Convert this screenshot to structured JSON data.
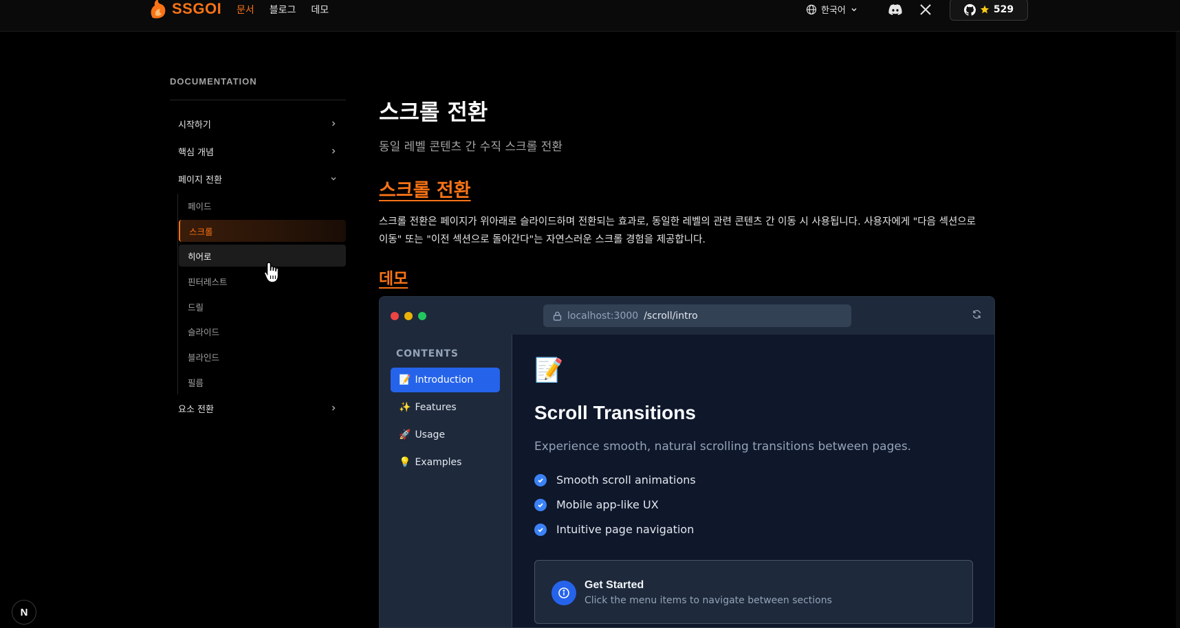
{
  "topnav": {
    "brand": "SSGOI",
    "links": [
      {
        "label": "문서",
        "active": true
      },
      {
        "label": "블로그",
        "active": false
      },
      {
        "label": "데모",
        "active": false
      }
    ],
    "language": "한국어",
    "github_stars": "529",
    "icons": [
      "globe-icon",
      "chevron-down-icon",
      "discord-icon",
      "x-icon",
      "github-icon",
      "star-icon"
    ]
  },
  "sidebar": {
    "heading": "DOCUMENTATION",
    "sections": [
      {
        "label": "시작하기",
        "expanded": false
      },
      {
        "label": "핵심 개념",
        "expanded": false
      },
      {
        "label": "페이지 전환",
        "expanded": true
      },
      {
        "label": "요소 전환",
        "expanded": false
      }
    ],
    "page_transitions": [
      {
        "label": "페이드",
        "state": "normal"
      },
      {
        "label": "스크롤",
        "state": "active"
      },
      {
        "label": "히어로",
        "state": "hover"
      },
      {
        "label": "핀터레스트",
        "state": "normal"
      },
      {
        "label": "드릴",
        "state": "normal"
      },
      {
        "label": "슬라이드",
        "state": "normal"
      },
      {
        "label": "블라인드",
        "state": "normal"
      },
      {
        "label": "필름",
        "state": "normal"
      }
    ]
  },
  "main": {
    "title": "스크롤 전환",
    "subtitle": "동일 레벨 콘텐츠 간 수직 스크롤 전환",
    "section_heading": "스크롤 전환",
    "paragraph_line1": "스크롤 전환은 페이지가 위아래로 슬라이드하며 전환되는 효과로, 동일한 레벨의 관련 콘텐츠 간 이동 시 사용됩니다. 사용자에게 \"다음 섹션으로",
    "paragraph_line2": "이동\" 또는 \"이전 섹션으로 돌아간다\"는 자연스러운 스크롤 경험을 제공합니다.",
    "demo_heading": "데모"
  },
  "demo": {
    "url_host": "localhost:3000",
    "url_path": "/scroll/intro",
    "contents_heading": "CONTENTS",
    "toc": [
      {
        "emoji": "📝",
        "label": "Introduction",
        "active": true
      },
      {
        "emoji": "✨",
        "label": "Features",
        "active": false
      },
      {
        "emoji": "🚀",
        "label": "Usage",
        "active": false
      },
      {
        "emoji": "💡",
        "label": "Examples",
        "active": false
      }
    ],
    "hero_emoji": "📝",
    "title": "Scroll Transitions",
    "subtitle": "Experience smooth, natural scrolling transitions between pages.",
    "features": [
      "Smooth scroll animations",
      "Mobile app-like UX",
      "Intuitive page navigation"
    ],
    "callout_title": "Get Started",
    "callout_text": "Click the menu items to navigate between sections"
  },
  "next_badge": "N",
  "colors": {
    "accent": "#f97316",
    "demo_accent": "#2563eb",
    "background": "#000000"
  }
}
